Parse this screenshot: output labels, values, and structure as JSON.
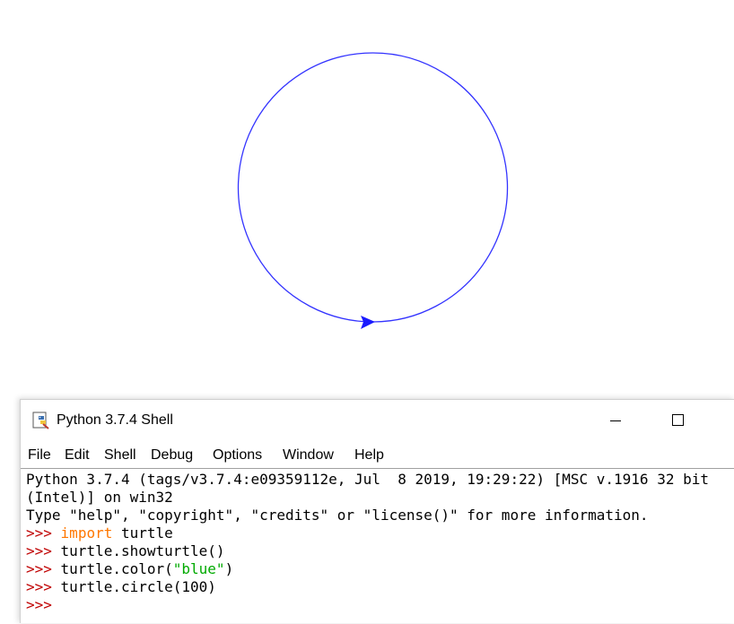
{
  "canvas": {
    "pen_color": "#3333ff",
    "turtle_shape": "classic-arrow-icon"
  },
  "window": {
    "title": "Python 3.7.4 Shell",
    "icon": "python-idle-icon"
  },
  "menu": {
    "items": [
      "File",
      "Edit",
      "Shell",
      "Debug",
      "Options",
      "Window",
      "Help"
    ]
  },
  "shell": {
    "banner_line1": "Python 3.7.4 (tags/v3.7.4:e09359112e, Jul  8 2019, 19:29:22) [MSC v.1916 32 bit",
    "banner_line2": "(Intel)] on win32",
    "banner_line3": "Type \"help\", \"copyright\", \"credits\" or \"license()\" for more information.",
    "prompt": ">>>",
    "cmd1_keyword": "import",
    "cmd1_rest": " turtle",
    "cmd2": " turtle.showturtle()",
    "cmd3_pre": " turtle.color(",
    "cmd3_str": "\"blue\"",
    "cmd3_post": ")",
    "cmd4": " turtle.circle(100)"
  },
  "colors": {
    "prompt": "#c00000",
    "keyword": "#ff7700",
    "string": "#00aa00"
  }
}
